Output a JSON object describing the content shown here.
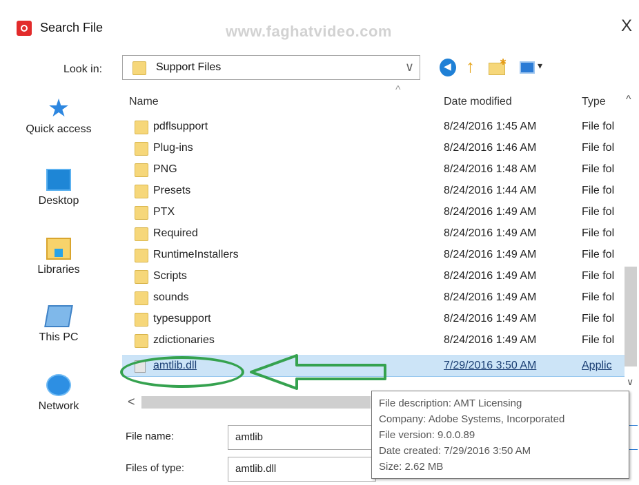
{
  "window": {
    "title": "Search File",
    "watermark": "www.faghatvideo.com",
    "close_glyph": "X"
  },
  "toolbar": {
    "lookin_label": "Look in:",
    "lookin_value": "Support Files",
    "chevron": "∨",
    "buttons": [
      "back-icon",
      "up-folder-icon",
      "new-folder-icon",
      "views-menu-icon"
    ]
  },
  "places": [
    {
      "label": "Quick access",
      "icon": "quick-access-star-icon"
    },
    {
      "label": "Desktop",
      "icon": "desktop-icon"
    },
    {
      "label": "Libraries",
      "icon": "libraries-icon"
    },
    {
      "label": "This PC",
      "icon": "this-pc-icon"
    },
    {
      "label": "Network",
      "icon": "network-icon"
    }
  ],
  "columns": {
    "name": "Name",
    "date": "Date modified",
    "type": "Type",
    "sort_glyph": "^",
    "scroll_up": "^",
    "scroll_down": "∨"
  },
  "files": [
    {
      "name": "pdflsupport",
      "date": "8/24/2016 1:45 AM",
      "type": "File fol"
    },
    {
      "name": "Plug-ins",
      "date": "8/24/2016 1:46 AM",
      "type": "File fol"
    },
    {
      "name": "PNG",
      "date": "8/24/2016 1:48 AM",
      "type": "File fol"
    },
    {
      "name": "Presets",
      "date": "8/24/2016 1:44 AM",
      "type": "File fol"
    },
    {
      "name": "PTX",
      "date": "8/24/2016 1:49 AM",
      "type": "File fol"
    },
    {
      "name": "Required",
      "date": "8/24/2016 1:49 AM",
      "type": "File fol"
    },
    {
      "name": "RuntimeInstallers",
      "date": "8/24/2016 1:49 AM",
      "type": "File fol"
    },
    {
      "name": "Scripts",
      "date": "8/24/2016 1:49 AM",
      "type": "File fol"
    },
    {
      "name": "sounds",
      "date": "8/24/2016 1:49 AM",
      "type": "File fol"
    },
    {
      "name": "typesupport",
      "date": "8/24/2016 1:49 AM",
      "type": "File fol"
    },
    {
      "name": "zdictionaries",
      "date": "8/24/2016 1:49 AM",
      "type": "File fol"
    },
    {
      "name": "amtlib.dll",
      "date": "7/29/2016 3:50 AM",
      "type": "Applic"
    }
  ],
  "hscroll": {
    "left_glyph": "<"
  },
  "fields": {
    "file_name_label": "File name:",
    "file_name_value": "amtlib",
    "file_type_label": "Files of type:",
    "file_type_value": "amtlib.dll"
  },
  "tooltip": {
    "description": "File description: AMT Licensing",
    "company": "Company: Adobe Systems, Incorporated",
    "version": "File version: 9.0.0.89",
    "created": "Date created: 7/29/2016 3:50 AM",
    "size": "Size: 2.62 MB"
  },
  "colors": {
    "accent": "#1f80d6",
    "selection": "#cce4f7",
    "annotation": "#35a24f"
  }
}
